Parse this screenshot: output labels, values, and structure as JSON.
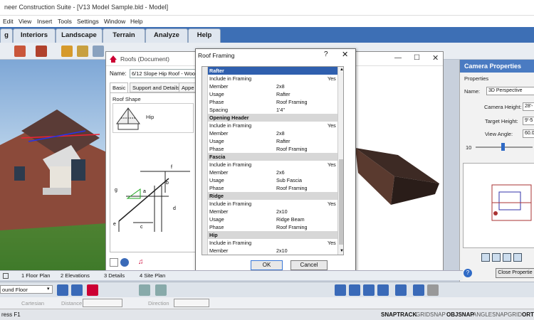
{
  "window": {
    "title": "neer Construction Suite - [V13 Model Sample.bld - Model]"
  },
  "menu": [
    "Edit",
    "View",
    "Insert",
    "Tools",
    "Settings",
    "Window",
    "Help"
  ],
  "ribbon_tabs": [
    "g",
    "Interiors",
    "Landscape",
    "Terrain",
    "Analyze",
    "Help"
  ],
  "roofs_dialog": {
    "title": "Roofs (Document)",
    "name_label": "Name:",
    "name_value": "6/12 Slope Hip Roof - Woo",
    "tabs": [
      "Basic",
      "Support and Details",
      "Appe"
    ],
    "roof_shape_label": "Roof Shape",
    "roof_shape_value": "Hip",
    "diagram_labels": [
      "f",
      "b",
      "g",
      "a",
      "d",
      "e",
      "c"
    ]
  },
  "framing_dialog": {
    "title": "Roof Framing",
    "help": "?",
    "close": "✕",
    "rows": [
      {
        "type": "section",
        "label": "Rafter",
        "selected": true
      },
      {
        "type": "prop",
        "name": "Include in Framing",
        "value": "",
        "flag": "Yes"
      },
      {
        "type": "prop",
        "name": "Member",
        "value": "2x8",
        "flag": ""
      },
      {
        "type": "prop",
        "name": "Usage",
        "value": "Rafter",
        "flag": ""
      },
      {
        "type": "prop",
        "name": "Phase",
        "value": "Roof Framing",
        "flag": ""
      },
      {
        "type": "prop",
        "name": "Spacing",
        "value": "1'4\"",
        "flag": ""
      },
      {
        "type": "section",
        "label": "Opening Header",
        "selected": false
      },
      {
        "type": "prop",
        "name": "Include in Framing",
        "value": "",
        "flag": "Yes"
      },
      {
        "type": "prop",
        "name": "Member",
        "value": "2x8",
        "flag": ""
      },
      {
        "type": "prop",
        "name": "Usage",
        "value": "Rafter",
        "flag": ""
      },
      {
        "type": "prop",
        "name": "Phase",
        "value": "Roof Framing",
        "flag": ""
      },
      {
        "type": "section",
        "label": "Fascia",
        "selected": false
      },
      {
        "type": "prop",
        "name": "Include in Framing",
        "value": "",
        "flag": "Yes"
      },
      {
        "type": "prop",
        "name": "Member",
        "value": "2x6",
        "flag": ""
      },
      {
        "type": "prop",
        "name": "Usage",
        "value": "Sub Fascia",
        "flag": ""
      },
      {
        "type": "prop",
        "name": "Phase",
        "value": "Roof Framing",
        "flag": ""
      },
      {
        "type": "section",
        "label": "Ridge",
        "selected": false
      },
      {
        "type": "prop",
        "name": "Include in Framing",
        "value": "",
        "flag": "Yes"
      },
      {
        "type": "prop",
        "name": "Member",
        "value": "2x10",
        "flag": ""
      },
      {
        "type": "prop",
        "name": "Usage",
        "value": "Ridge Beam",
        "flag": ""
      },
      {
        "type": "prop",
        "name": "Phase",
        "value": "Roof Framing",
        "flag": ""
      },
      {
        "type": "section",
        "label": "Hip",
        "selected": false
      },
      {
        "type": "prop",
        "name": "Include in Framing",
        "value": "",
        "flag": "Yes"
      },
      {
        "type": "prop",
        "name": "Member",
        "value": "2x10",
        "flag": ""
      }
    ],
    "ok": "OK",
    "cancel": "Cancel"
  },
  "camera_panel": {
    "title": "Camera Properties",
    "properties_label": "Properties",
    "name_label": "Name:",
    "name_value": "3D Perspective",
    "camera_height_label": "Camera Height:",
    "camera_height_value": "28'-",
    "target_height_label": "Target Height:",
    "target_height_value": "9'-5",
    "view_angle_label": "View Angle:",
    "view_angle_value": "60.0",
    "slider_label": "10",
    "close_button": "Close Propertie"
  },
  "bottom_tabs": [
    "1 Floor Plan",
    "2 Elevations",
    "3 Details",
    "4 Site Plan"
  ],
  "floor_select": "ound Floor",
  "status_inputs": {
    "a": "Cartesian",
    "b": "Distance",
    "c": "Direction"
  },
  "status_left": "ress F1",
  "status_items": [
    "SNAPTRACK",
    "GRIDSNAP",
    "OBJSNAP",
    "ANGLESNAP",
    "GRID",
    "ORT"
  ],
  "colors": {
    "ribbon": "#3d6fb5",
    "selection": "#2f5fae",
    "camera_header": "#4a7bc2"
  }
}
